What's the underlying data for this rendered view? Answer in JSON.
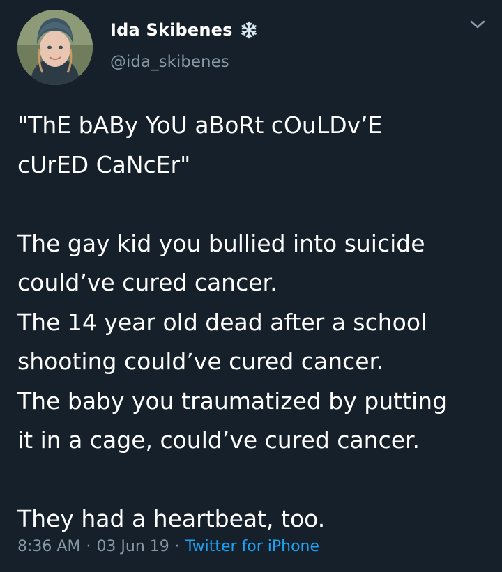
{
  "tweet": {
    "author": {
      "display_name": "Ida Skibenes",
      "handle": "@ida_skibenes",
      "name_emoji_icon": "snowflake-icon",
      "avatar": "profile-photo"
    },
    "menu_icon": "chevron-down-icon",
    "lines": {
      "l1": "\"ThE bABy YoU aBoRt cOuLDv’E",
      "l2": "cUrED CaNcEr\"",
      "l3": "The gay kid you bullied into suicide",
      "l4": "could’ve cured cancer.",
      "l5": "The 14 year old dead after a school",
      "l6": "shooting could’ve cured cancer.",
      "l7": "The baby you traumatized by putting",
      "l8": "it in a cage, could’ve cured cancer.",
      "l9": "They had a heartbeat, too."
    },
    "meta": {
      "time": "8:36 AM",
      "date": "03 Jun 19",
      "separator": "·",
      "source": "Twitter for iPhone"
    }
  },
  "colors": {
    "background": "#15202b",
    "text": "#ffffff",
    "secondary": "#8899a6",
    "link": "#1da1f2"
  }
}
